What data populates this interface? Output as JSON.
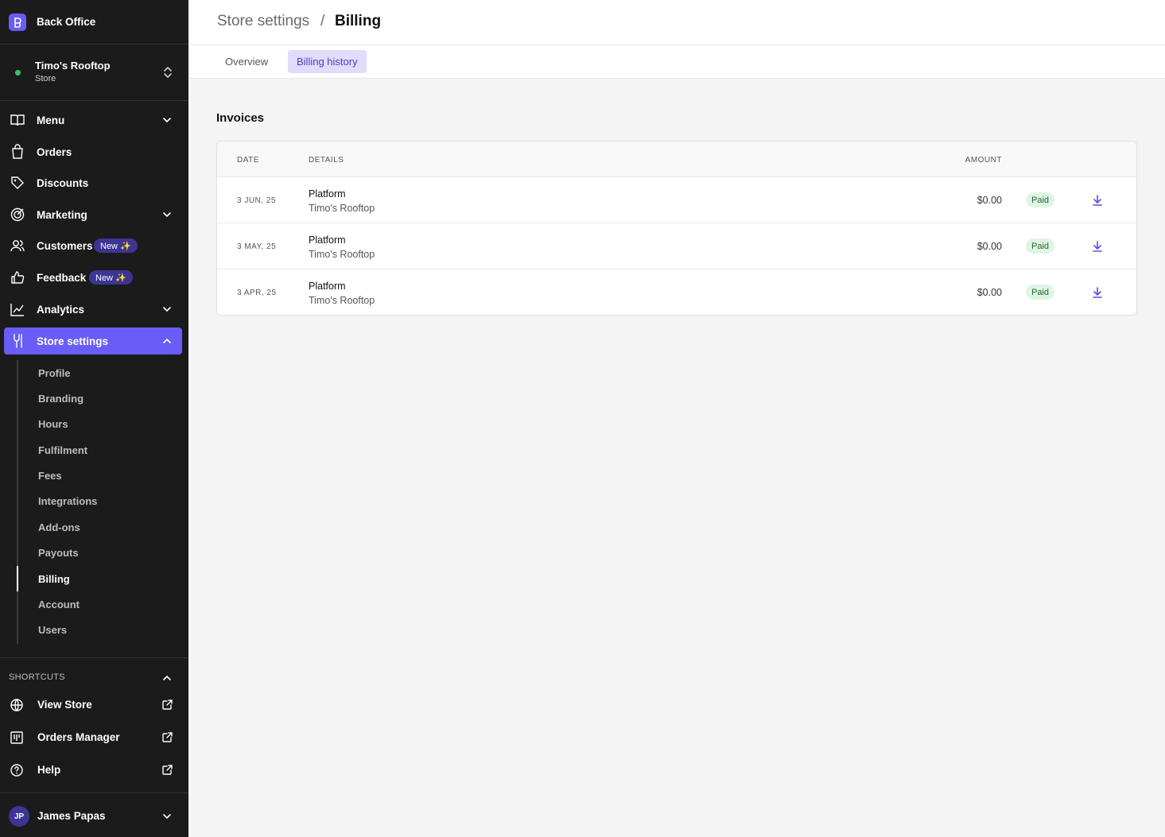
{
  "app": {
    "name": "Back Office"
  },
  "store": {
    "name": "Timo's Rooftop",
    "type": "Store"
  },
  "nav": {
    "menu": "Menu",
    "orders": "Orders",
    "discounts": "Discounts",
    "marketing": "Marketing",
    "customers": "Customers",
    "feedback": "Feedback",
    "analytics": "Analytics",
    "store_settings": "Store settings",
    "new_badge": "New ✨"
  },
  "subnav": {
    "profile": "Profile",
    "branding": "Branding",
    "hours": "Hours",
    "fulfilment": "Fulfilment",
    "fees": "Fees",
    "integrations": "Integrations",
    "addons": "Add-ons",
    "payouts": "Payouts",
    "billing": "Billing",
    "account": "Account",
    "users": "Users"
  },
  "shortcuts": {
    "title": "SHORTCUTS",
    "view_store": "View Store",
    "orders_manager": "Orders Manager",
    "help": "Help"
  },
  "user": {
    "initials": "JP",
    "name": "James Papas"
  },
  "breadcrumb": {
    "parent": "Store settings",
    "separator": "/",
    "current": "Billing"
  },
  "tabs": {
    "overview": "Overview",
    "billing_history": "Billing history"
  },
  "invoices": {
    "title": "Invoices",
    "headers": {
      "date": "DATE",
      "details": "DETAILS",
      "amount": "AMOUNT"
    },
    "rows": [
      {
        "date": "3 JUN, 25",
        "title": "Platform",
        "subtitle": "Timo's Rooftop",
        "amount": "$0.00",
        "status": "Paid"
      },
      {
        "date": "3 MAY, 25",
        "title": "Platform",
        "subtitle": "Timo's Rooftop",
        "amount": "$0.00",
        "status": "Paid"
      },
      {
        "date": "3 APR, 25",
        "title": "Platform",
        "subtitle": "Timo's Rooftop",
        "amount": "$0.00",
        "status": "Paid"
      }
    ]
  },
  "colors": {
    "accent": "#6a5cf6",
    "sidebar_bg": "#1b1b1b",
    "paid_bg": "#dff5e4",
    "paid_text": "#1d6a35"
  }
}
